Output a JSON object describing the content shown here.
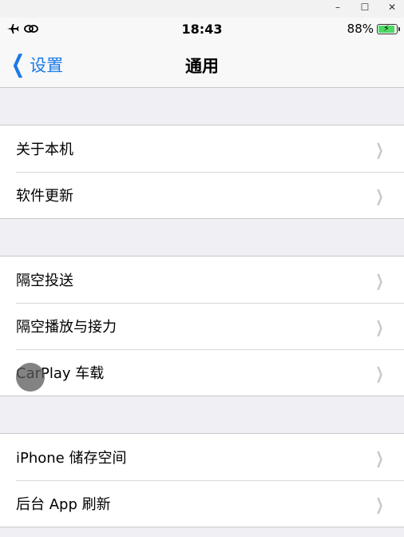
{
  "window": {
    "minimize": "–",
    "maximize": "☐",
    "close": "✕"
  },
  "status": {
    "time": "18:43",
    "battery": "88%",
    "left_icons": [
      "airplane-icon",
      "link-icon"
    ]
  },
  "nav": {
    "back_label": "设置",
    "title": "通用"
  },
  "groups": [
    {
      "items": [
        "关于本机",
        "软件更新"
      ]
    },
    {
      "items": [
        "隔空投送",
        "隔空播放与接力",
        "CarPlay 车载"
      ]
    },
    {
      "items": [
        "iPhone 储存空间",
        "后台 App 刷新"
      ]
    }
  ],
  "colors": {
    "accent": "#1a7ae6",
    "background": "#efeff4",
    "battery_fill": "#4cd964"
  }
}
